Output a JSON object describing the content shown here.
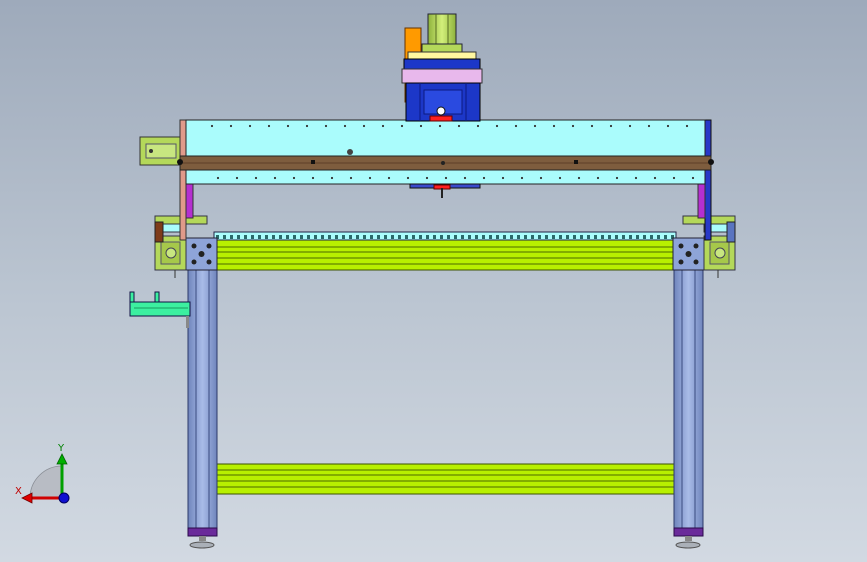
{
  "viewport": {
    "background_top": "#9eaabb",
    "background_bottom": "#d2d9e2"
  },
  "colors": {
    "beam": "#aafcfc",
    "rail": "#7e5d3e",
    "green_extrusion": "#b8f000",
    "leg": "#8ea4d8",
    "spindle_motor": "#b4d85a",
    "carriage": "#1c37c8",
    "carriage_plate": "#e8b8ec",
    "accent_orange": "#ff9a00",
    "accent_magenta": "#b52fd0",
    "mint_bracket": "#3cf0a0",
    "foot_plate": "#6a2a9a"
  },
  "triad": {
    "x_label": "X",
    "y_label": "Y",
    "x_color": "#c00000",
    "y_color": "#009000",
    "z_color": "#1010d0"
  }
}
